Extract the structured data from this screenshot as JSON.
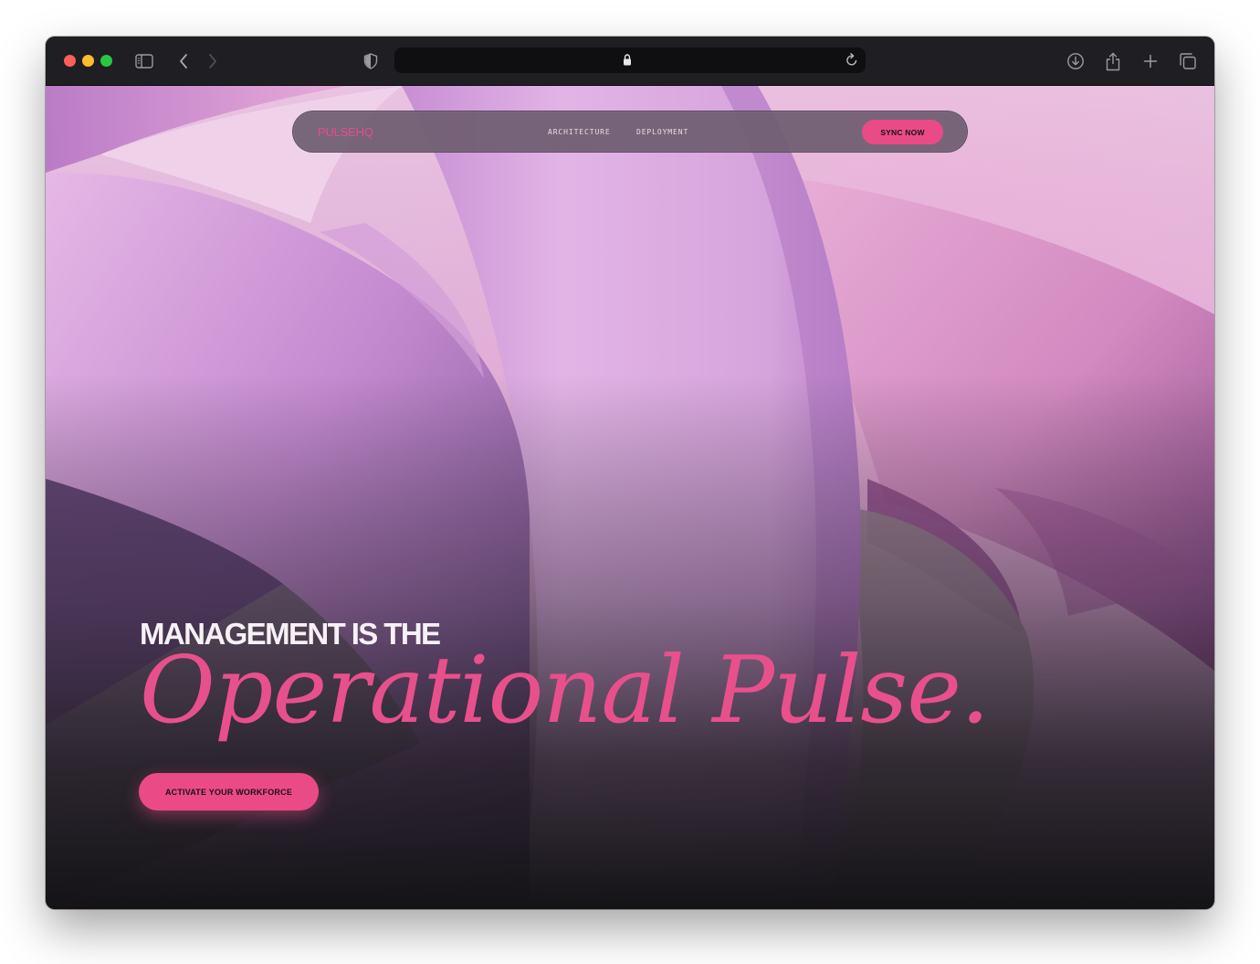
{
  "browser": {
    "controls": {
      "close": "close-window",
      "minimize": "minimize-window",
      "zoom": "zoom-window"
    },
    "icons": {
      "sidebar": "sidebar-icon",
      "back": "chevron-left-icon",
      "forward": "chevron-right-icon",
      "privacy": "shield-icon",
      "lock": "lock-icon",
      "reload": "reload-icon",
      "downloads": "download-icon",
      "share": "share-icon",
      "new_tab": "plus-icon",
      "tab_overview": "tabs-icon"
    },
    "address_value": ""
  },
  "nav": {
    "brand": "PULSEHQ",
    "links": [
      {
        "label": "ARCHITECTURE"
      },
      {
        "label": "DEPLOYMENT"
      }
    ],
    "cta_label": "SYNC NOW"
  },
  "hero": {
    "eyebrow": "MANAGEMENT IS THE",
    "title": "Operational Pulse.",
    "cta_label": "ACTIVATE YOUR WORKFORCE"
  },
  "colors": {
    "accent": "#ea4b87",
    "title_pink": "#e8508c",
    "toolbar": "#1f1e22",
    "nav_pill": "#6e5c70",
    "bg_light": "#e3bfdc",
    "bg_dark": "#19171c"
  }
}
